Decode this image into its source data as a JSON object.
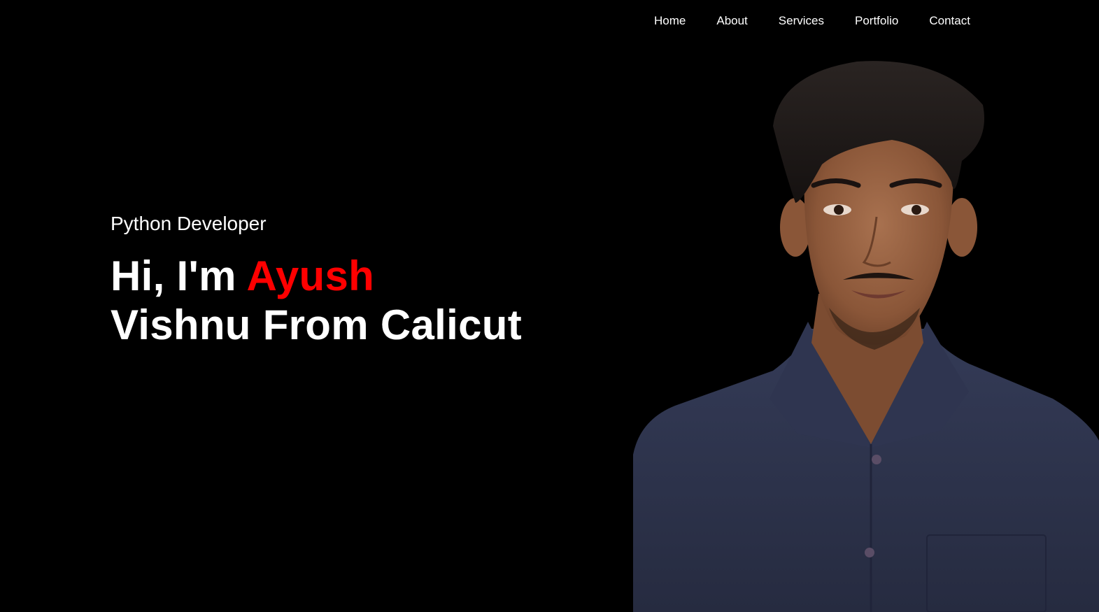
{
  "nav": {
    "items": [
      {
        "label": "Home"
      },
      {
        "label": "About"
      },
      {
        "label": "Services"
      },
      {
        "label": "Portfolio"
      },
      {
        "label": "Contact"
      }
    ]
  },
  "hero": {
    "role": "Python Developer",
    "greeting": "Hi, I'm ",
    "name_highlight": "Ayush",
    "name_rest": "Vishnu From Calicut"
  },
  "colors": {
    "background": "#000000",
    "text": "#ffffff",
    "accent": "#ff0000",
    "shirt": "#2b3148"
  },
  "portrait": {
    "icon": "person-portrait"
  }
}
